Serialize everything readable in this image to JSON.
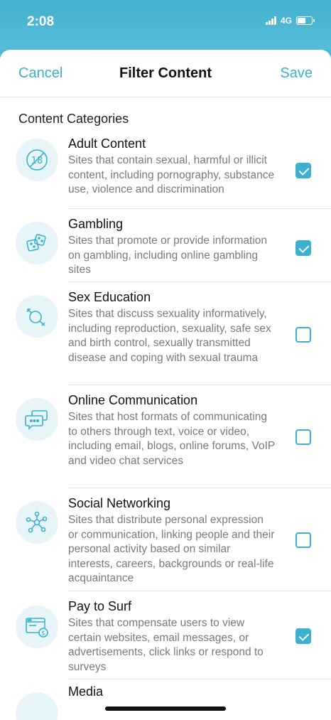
{
  "status": {
    "time": "2:08",
    "network": "4G"
  },
  "nav": {
    "cancel": "Cancel",
    "title": "Filter Content",
    "save": "Save"
  },
  "section_header": "Content Categories",
  "categories": [
    {
      "title": "Adult Content",
      "desc": "Sites that contain sexual, harmful or illicit content, including pornography, substance use, violence and discrimination",
      "checked": true,
      "icon": "adult-18-icon"
    },
    {
      "title": "Gambling",
      "desc": "Sites that promote or provide information on gambling, including online gambling sites",
      "checked": true,
      "icon": "dice-icon"
    },
    {
      "title": "Sex Education",
      "desc": "Sites that discuss sexuality informatively, including reproduction, sexuality, safe sex and birth control, sexually transmitted disease and coping with sexual trauma",
      "checked": false,
      "icon": "gender-icon"
    },
    {
      "title": "Online Communication",
      "desc": "Sites that host formats of communicating to others through text, voice or video, including email, blogs, online forums, VoIP and video chat services",
      "checked": false,
      "icon": "chat-bubbles-icon"
    },
    {
      "title": "Social Networking",
      "desc": "Sites that distribute personal expression or communication, linking people and their personal activity based on similar interests, careers, backgrounds or real-life acquaintance",
      "checked": false,
      "icon": "network-icon"
    },
    {
      "title": "Pay to Surf",
      "desc": "Sites that compensate users to view certain websites, email messages, or advertisements, click links or respond to surveys",
      "checked": true,
      "icon": "pay-browser-icon"
    },
    {
      "title": "Media",
      "desc": "",
      "checked": false,
      "icon": "media-icon"
    }
  ],
  "accent_color": "#3bb0cf"
}
